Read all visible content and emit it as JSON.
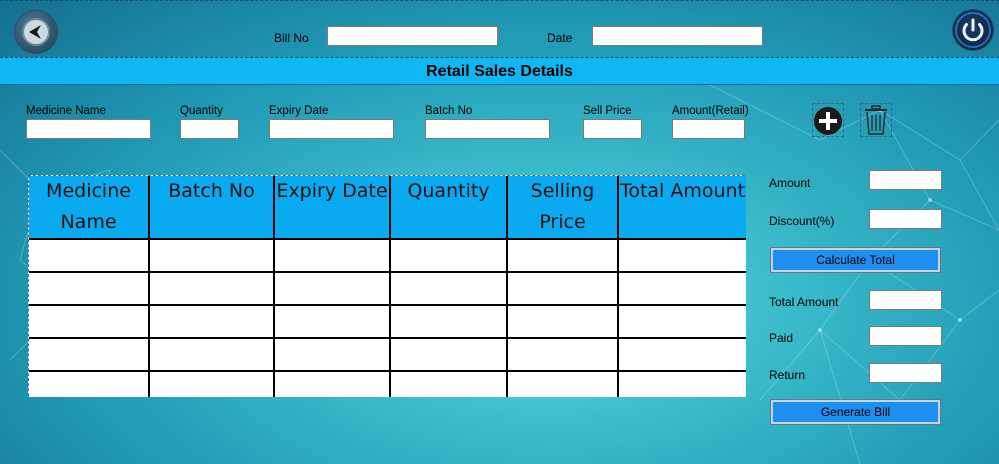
{
  "header": {
    "bill_no_label": "Bill No",
    "bill_no_value": "",
    "date_label": "Date",
    "date_value": ""
  },
  "title": "Retail Sales Details",
  "entry": {
    "medicine_name_label": "Medicine Name",
    "quantity_label": "Quantity",
    "expiry_date_label": "Expiry Date",
    "batch_no_label": "Batch No",
    "sell_price_label": "Sell Price",
    "amount_retail_label": "Amount(Retail)"
  },
  "icons": {
    "back": "back-arrow-icon",
    "power": "power-icon",
    "add": "plus-circle-icon",
    "delete": "trash-icon"
  },
  "grid": {
    "columns": [
      "Medicine Name",
      "Batch No",
      "Expiry Date",
      "Quantity",
      "Selling Price",
      "Total Amount"
    ],
    "rows": [
      [
        "",
        "",
        "",
        "",
        "",
        ""
      ],
      [
        "",
        "",
        "",
        "",
        "",
        ""
      ],
      [
        "",
        "",
        "",
        "",
        "",
        ""
      ],
      [
        "",
        "",
        "",
        "",
        "",
        ""
      ],
      [
        "",
        "",
        "",
        "",
        "",
        ""
      ]
    ]
  },
  "summary": {
    "amount_label": "Amount",
    "discount_label": "Discount(%)",
    "calculate_label": "Calculate Total",
    "total_amount_label": "Total Amount",
    "paid_label": "Paid",
    "return_label": "Return",
    "generate_label": "Generate Bill"
  },
  "colors": {
    "title_bar": "#10b7f3",
    "grid_header": "#0aaaf0",
    "button": "#1e8ff0",
    "background": "#3bbccb"
  }
}
